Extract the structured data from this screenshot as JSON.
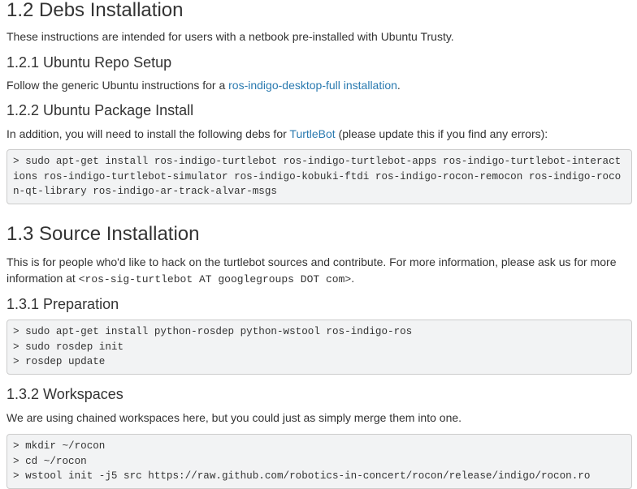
{
  "sections": {
    "s12": {
      "title": "1.2 Debs Installation",
      "intro": "These instructions are intended for users with a netbook pre-installed with Ubuntu Trusty.",
      "s121_title": "1.2.1 Ubuntu Repo Setup",
      "s121_text_before": "Follow the generic Ubuntu instructions for a ",
      "s121_link": "ros-indigo-desktop-full installation",
      "s121_text_after": ".",
      "s122_title": "1.2.2 Ubuntu Package Install",
      "s122_text_before": "In addition, you will need to install the following debs for ",
      "s122_link": "TurtleBot",
      "s122_text_after": " (please update this if you find any errors):",
      "s122_code": "> sudo apt-get install ros-indigo-turtlebot ros-indigo-turtlebot-apps ros-indigo-turtlebot-interactions ros-indigo-turtlebot-simulator ros-indigo-kobuki-ftdi ros-indigo-rocon-remocon ros-indigo-rocon-qt-library ros-indigo-ar-track-alvar-msgs"
    },
    "s13": {
      "title": "1.3 Source Installation",
      "intro_before": "This is for people who'd like to hack on the turtlebot sources and contribute. For more information, please ask us for more information at ",
      "intro_code": "<ros-sig-turtlebot AT googlegroups DOT com>",
      "intro_after": ".",
      "s131_title": "1.3.1 Preparation",
      "s131_code": "> sudo apt-get install python-rosdep python-wstool ros-indigo-ros\n> sudo rosdep init\n> rosdep update",
      "s132_title": "1.3.2 Workspaces",
      "s132_text": "We are using chained workspaces here, but you could just as simply merge them into one.",
      "s132_code": "> mkdir ~/rocon\n> cd ~/rocon\n> wstool init -j5 src https://raw.github.com/robotics-in-concert/rocon/release/indigo/rocon.ro"
    }
  }
}
